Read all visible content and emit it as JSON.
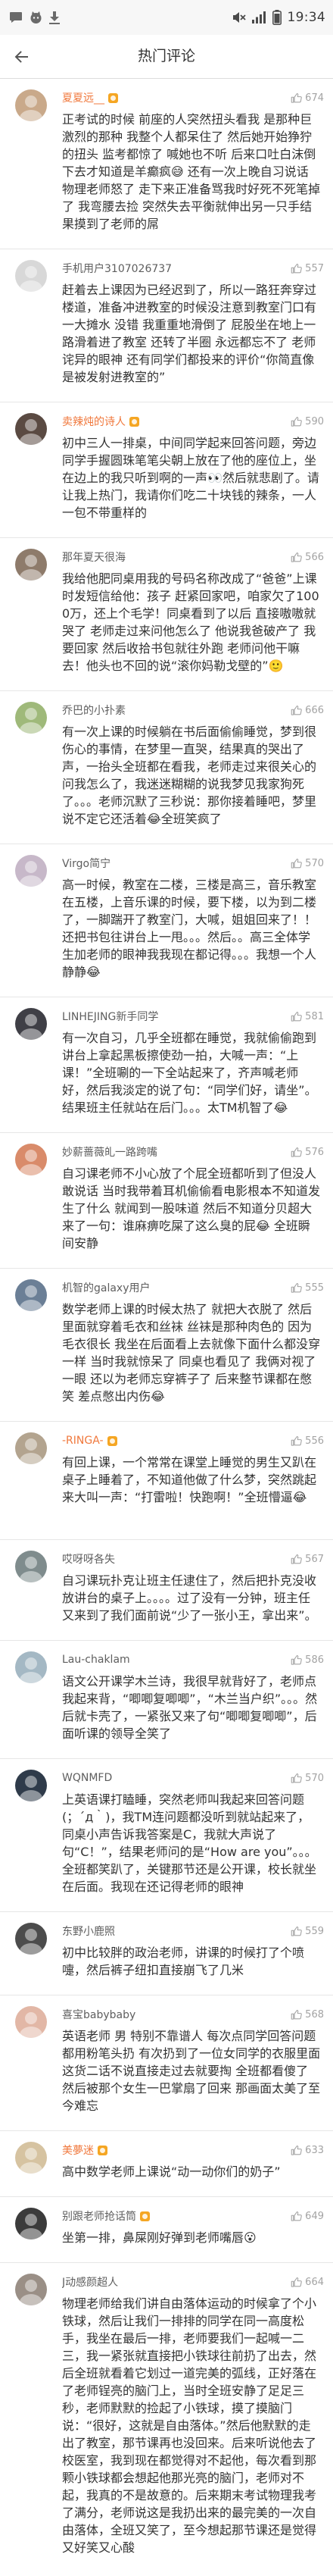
{
  "status_bar": {
    "time": "19:34",
    "left_icons": [
      "chat-notification-icon",
      "app-notification-icon",
      "download-notification-icon"
    ],
    "right_icons": [
      "mute-icon",
      "signal-icon",
      "battery-icon"
    ]
  },
  "header": {
    "title": "热门评论",
    "back_icon": "back-arrow-icon"
  },
  "colors": {
    "highlight_username": "#f0783c",
    "username": "#5e5e5e",
    "text": "#333333",
    "likes": "#a3a3a3",
    "divider": "#e6e6e6"
  },
  "comments": [
    {
      "username": "夏夏远__",
      "name_color": "#f0783c",
      "badge": true,
      "avatar_color": "#c9a98a",
      "likes": "674",
      "text": "正考试的时候 前座的人突然扭头看我 是那种巨激烈的那种 我整个人都呆住了 然后她开始狰狞的扭头 监考都惊了 喊她也不听 后来口吐白沫倒下去才知道是羊癫疯😅 还有一次上晚自习说话 物理老师怒了 走下来正准备骂我时好死不死笔掉了 我弯腰去捡 突然失去平衡就伸出另一只手结果摸到了老师的屌"
    },
    {
      "username": "手机用户3107026737",
      "name_color": "#5e5e5e",
      "badge": false,
      "avatar_color": "#d8d8d8",
      "likes": "557",
      "text": "赶着去上课因为已经迟到了，所以一路狂奔穿过楼道，准备冲进教室的时候没注意到教室门口有一大摊水 没错 我重重地滑倒了 屁股坐在地上一路滑着进了教室 还转了半圈 永远都忘不了 老师诧异的眼神 还有同学们都投来的评价“你简直像是被发射进教室的”"
    },
    {
      "username": "卖辣炖的诗人",
      "name_color": "#f0783c",
      "badge": true,
      "avatar_color": "#5a4a42",
      "likes": "590",
      "text": "初中三人一排桌，中间同学起来回答问题，旁边同学手握圆珠笔笔尖朝上放在了他的座位上，坐在边上的我只听到啊的一声👀然后就悲剧了。请让我上热门，我请你们吃二十块钱的辣条，一人一包不带重样的"
    },
    {
      "username": "那年夏天很海",
      "name_color": "#5e5e5e",
      "badge": false,
      "avatar_color": "#8e7b6b",
      "likes": "566",
      "text": "我给他肥同桌用我的号码名称改成了“爸爸”上课时发短信给他：孩子 赶紧回家吧，咱家欠了1000万，还上个毛学！同桌看到了以后 直接嗷嗷就哭了 老师走过来问他怎么了 他说我爸破产了 我要回家 然后收拾书包就往外跑 老师问他干嘛去！他头也不回的说“滚你妈勒戈壁的”🙂"
    },
    {
      "username": "乔巴的小扑素",
      "name_color": "#5e5e5e",
      "badge": false,
      "avatar_color": "#9fb97a",
      "likes": "666",
      "text": "有一次上课的时候躺在书后面偷偷睡觉，梦到很伤心的事情，在梦里一直哭，结果真的哭出了声，一抬头全班都在看我，老师走过来很关心的问我怎么了，我迷迷糊糊的说我梦见我家狗死了。。。老师沉默了三秒说：那你接着睡吧，梦里说不定它还活着😂全班笑疯了"
    },
    {
      "username": "Virgo简宁",
      "name_color": "#5e5e5e",
      "badge": false,
      "avatar_color": "#c7b8c9",
      "likes": "570",
      "text": "高一时候，教室在二楼，三楼是高三，音乐教室在五楼，上音乐课的时候，要下楼，以为到二楼了，一脚踹开了教室门，大喊，姐姐回来了！！还把书包往讲台上一甩。。。然后。。高三全体学生加老师的眼神我我现在都记得。。。我想一个人静静😂"
    },
    {
      "username": "LINHEJING新手同学",
      "name_color": "#5e5e5e",
      "badge": false,
      "avatar_color": "#3f3f46",
      "likes": "581",
      "text": "有一次自习，几乎全班都在睡觉，我就偷偷跑到讲台上拿起黑板擦使劲一拍，大喊一声：“上课！”全班唰的一下全站起来了，齐声喊老师好，然后我淡定的说了句：“同学们好，请坐”。结果班主任就站在后门。。。太TM机智了😂"
    },
    {
      "username": "妙薪蔷薇癿一路跨嘴",
      "name_color": "#5e5e5e",
      "badge": false,
      "avatar_color": "#d98b6a",
      "likes": "576",
      "text": "自习课老师不小心放了个屁全班都听到了但没人敢说话 当时我带着耳机偷偷看电影根本不知道发生了什么 就闻到一股味道 然后不知道分贝超大来了一句：谁麻痹吃屎了这么臭的屁😂 全班瞬间安静"
    },
    {
      "username": "机智的galaxy用户",
      "name_color": "#5e5e5e",
      "badge": false,
      "avatar_color": "#6b7f96",
      "likes": "555",
      "text": "数学老师上课的时候太热了 就把大衣脱了 然后里面就穿着毛衣和丝袜 丝袜是那种肉色的 因为毛衣很长 我坐在后面看上去就像下面什么都没穿一样 当时我就惊呆了 同桌也看见了 我俩对视了一眼 还以为老师忘穿裤子了 后来整节课都在憋笑 差点憋出内伤😂"
    },
    {
      "username": "-RINGA-",
      "name_color": "#f0783c",
      "badge": true,
      "avatar_color": "#b3a48f",
      "likes": "556",
      "text": "有回上课，一个常常在课堂上睡觉的男生又趴在桌子上睡着了，不知道他做了什么梦，突然跳起来大叫一声：“打雷啦！快跑啊！”全班懵逼😂"
    },
    {
      "username": "哎呀呀各失",
      "name_color": "#5e5e5e",
      "badge": false,
      "avatar_color": "#7f8c8d",
      "likes": "567",
      "text": "自习课玩扑克让班主任逮住了，然后把扑克没收放讲台的桌子上。。。。过了没有一分钟，班主任又来到了我们面前说“少了一张小王，拿出来”。"
    },
    {
      "username": "Lau-chaklam",
      "name_color": "#5e5e5e",
      "badge": false,
      "avatar_color": "#a4b8c4",
      "likes": "586",
      "text": "语文公开课学木兰诗，我很早就背好了，老师点我起来背，“唧唧复唧唧”，“木兰当户织”。。。然后就卡壳了，一紧张又来了句“唧唧复唧唧”，后面听课的领导全笑了"
    },
    {
      "username": "WQNMFD",
      "name_color": "#5e5e5e",
      "badge": false,
      "avatar_color": "#2f3b4a",
      "likes": "570",
      "text": "上英语课打瞌睡，突然老师叫我起来回答问题(；´д｀)，我TM连问题都没听到就站起来了，同桌小声告诉我答案是C，我就大声说了句“C！”，结果老师问的是“How are you”。。。全班都笑趴了，关键那节还是公开课，校长就坐在后面。我现在还记得老师的眼神"
    },
    {
      "username": "东野小鹿照",
      "name_color": "#5e5e5e",
      "badge": false,
      "avatar_color": "#4c4c4c",
      "likes": "559",
      "text": "初中比较胖的政治老师，讲课的时候打了个喷嚏，然后裤子纽扣直接崩飞了几米"
    },
    {
      "username": "喜宝babybaby",
      "name_color": "#5e5e5e",
      "badge": false,
      "avatar_color": "#e2b7a6",
      "likes": "568",
      "text": "英语老师 男 特别不靠谱人 每次点同学回答问题都用粉笔头扔 有次扔到了一位女同学的衣服里面 这货二话不说直接走过去就要掏 全班都看傻了 然后被那个女生一巴掌扇了回来 那画面太美了至今难忘"
    },
    {
      "username": "美夢迷",
      "name_color": "#f0783c",
      "badge": true,
      "avatar_color": "#d6c3a1",
      "likes": "633",
      "text": "高中数学老师上课说“动一动你们的奶子”"
    },
    {
      "username": "别跟老师抢话筒",
      "name_color": "#5e5e5e",
      "badge": true,
      "avatar_color": "#3b3b3b",
      "likes": "649",
      "text": "坐第一排，鼻屎刚好弹到老师嘴唇😮"
    },
    {
      "username": "J动感颜超人",
      "name_color": "#5e5e5e",
      "badge": false,
      "avatar_color": "#9a8f86",
      "likes": "664",
      "text": "物理老师给我们讲自由落体运动的时候拿了个小铁球，然后让我们一排排的同学在同一高度松手，我坐在最后一排，老师要我们一起喊一二三，我一紧张就直接把小铁球往前扔了出去，然后全班就看着它划过一道完美的弧线，正好落在了老师锃亮的脑门上，当时全班安静了足足三秒，老师默默的捡起了小铁球，摸了摸脑门说：“很好，这就是自由落体。”然后他默默的走出了教室，那节课再也没回来。后来听说他去了校医室，我到现在都觉得对不起他，每次看到那颗小铁球都会想起他那光亮的脑门，老师对不起，我真的不是故意的。后来期末考试物理我考了满分，老师说这是我扔出来的最完美的一次自由落体，全班又笑了，至今想起那节课还是觉得又好笑又心酸"
    }
  ]
}
